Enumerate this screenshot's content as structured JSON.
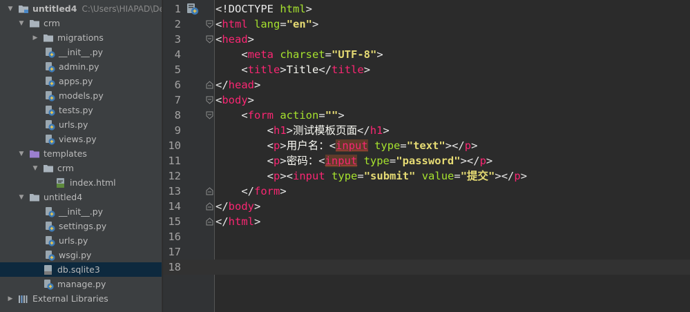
{
  "project_tree": {
    "root": {
      "label": "untitled4",
      "path": "C:\\Users\\HIAPAD\\Desk"
    },
    "items": [
      {
        "label": "crm",
        "kind": "folder",
        "expanded": true,
        "depth": 1
      },
      {
        "label": "migrations",
        "kind": "folder",
        "expanded": false,
        "depth": 2
      },
      {
        "label": "__init__.py",
        "kind": "python",
        "depth": 3
      },
      {
        "label": "admin.py",
        "kind": "python",
        "depth": 3
      },
      {
        "label": "apps.py",
        "kind": "python",
        "depth": 3
      },
      {
        "label": "models.py",
        "kind": "python",
        "depth": 3
      },
      {
        "label": "tests.py",
        "kind": "python",
        "depth": 3
      },
      {
        "label": "urls.py",
        "kind": "python",
        "depth": 3
      },
      {
        "label": "views.py",
        "kind": "python",
        "depth": 3
      },
      {
        "label": "templates",
        "kind": "folder-purple",
        "expanded": true,
        "depth": 1
      },
      {
        "label": "crm",
        "kind": "folder",
        "expanded": true,
        "depth": 2
      },
      {
        "label": "index.html",
        "kind": "html",
        "depth": 4
      },
      {
        "label": "untitled4",
        "kind": "folder",
        "expanded": true,
        "depth": 1
      },
      {
        "label": "__init__.py",
        "kind": "python",
        "depth": 3
      },
      {
        "label": "settings.py",
        "kind": "python",
        "depth": 3
      },
      {
        "label": "urls.py",
        "kind": "python",
        "depth": 3
      },
      {
        "label": "wsgi.py",
        "kind": "python",
        "depth": 3
      },
      {
        "label": "db.sqlite3",
        "kind": "db",
        "depth": 2,
        "selected": true
      },
      {
        "label": "manage.py",
        "kind": "python",
        "depth": 2
      },
      {
        "label": "External Libraries",
        "kind": "libraries",
        "expanded": false,
        "depth": 0
      }
    ]
  },
  "editor": {
    "current_line": 18,
    "lines": [
      {
        "num": "1",
        "tokens": [
          [
            "t-punct",
            "<!DOCTYPE "
          ],
          [
            "t-attr-a",
            "html"
          ],
          [
            "t-punct",
            ">"
          ]
        ]
      },
      {
        "num": "2",
        "tokens": [
          [
            "t-punct",
            "<"
          ],
          [
            "t-kw",
            "html"
          ],
          [
            "t-punct",
            " "
          ],
          [
            "t-attr-a",
            "lang"
          ],
          [
            "t-punct",
            "="
          ],
          [
            "t-str",
            "\"en\""
          ],
          [
            "t-punct",
            ">"
          ]
        ]
      },
      {
        "num": "3",
        "tokens": [
          [
            "t-punct",
            "<"
          ],
          [
            "t-kw",
            "head"
          ],
          [
            "t-punct",
            ">"
          ]
        ]
      },
      {
        "num": "4",
        "tokens": [
          [
            "t-punct",
            "    <"
          ],
          [
            "t-kw",
            "meta"
          ],
          [
            "t-punct",
            " "
          ],
          [
            "t-attr-a",
            "charset"
          ],
          [
            "t-punct",
            "="
          ],
          [
            "t-str",
            "\"UTF-8\""
          ],
          [
            "t-punct",
            ">"
          ]
        ]
      },
      {
        "num": "5",
        "tokens": [
          [
            "t-punct",
            "    <"
          ],
          [
            "t-kw",
            "title"
          ],
          [
            "t-punct",
            ">"
          ],
          [
            "t-text",
            "Title"
          ],
          [
            "t-punct",
            "</"
          ],
          [
            "t-kw",
            "title"
          ],
          [
            "t-punct",
            ">"
          ]
        ]
      },
      {
        "num": "6",
        "tokens": [
          [
            "t-punct",
            "</"
          ],
          [
            "t-kw",
            "head"
          ],
          [
            "t-punct",
            ">"
          ]
        ]
      },
      {
        "num": "7",
        "tokens": [
          [
            "t-punct",
            "<"
          ],
          [
            "t-kw",
            "body"
          ],
          [
            "t-punct",
            ">"
          ]
        ]
      },
      {
        "num": "8",
        "tokens": [
          [
            "t-punct",
            "    <"
          ],
          [
            "t-kw",
            "form"
          ],
          [
            "t-punct",
            " "
          ],
          [
            "t-attr-a",
            "action"
          ],
          [
            "t-punct",
            "="
          ],
          [
            "t-str",
            "\"\""
          ],
          [
            "t-punct",
            ">"
          ]
        ]
      },
      {
        "num": "9",
        "tokens": [
          [
            "t-punct",
            "        <"
          ],
          [
            "t-kw",
            "h1"
          ],
          [
            "t-punct",
            ">"
          ],
          [
            "t-text",
            "测试模板页面"
          ],
          [
            "t-punct",
            "</"
          ],
          [
            "t-kw",
            "h1"
          ],
          [
            "t-punct",
            ">"
          ]
        ]
      },
      {
        "num": "10",
        "tokens": [
          [
            "t-punct",
            "        <"
          ],
          [
            "t-kw",
            "p"
          ],
          [
            "t-punct",
            ">"
          ],
          [
            "t-text",
            "用户名："
          ],
          [
            "t-punct",
            "<"
          ],
          [
            "t-kw t-err",
            "input"
          ],
          [
            "t-punct",
            " "
          ],
          [
            "t-attr-a",
            "type"
          ],
          [
            "t-punct",
            "="
          ],
          [
            "t-str",
            "\"text\""
          ],
          [
            "t-punct",
            "></"
          ],
          [
            "t-kw",
            "p"
          ],
          [
            "t-punct",
            ">"
          ]
        ]
      },
      {
        "num": "11",
        "tokens": [
          [
            "t-punct",
            "        <"
          ],
          [
            "t-kw",
            "p"
          ],
          [
            "t-punct",
            ">"
          ],
          [
            "t-text",
            "密码："
          ],
          [
            "t-punct",
            "<"
          ],
          [
            "t-kw t-err",
            "input"
          ],
          [
            "t-punct",
            " "
          ],
          [
            "t-attr-a",
            "type"
          ],
          [
            "t-punct",
            "="
          ],
          [
            "t-str",
            "\"password\""
          ],
          [
            "t-punct",
            "></"
          ],
          [
            "t-kw",
            "p"
          ],
          [
            "t-punct",
            ">"
          ]
        ]
      },
      {
        "num": "12",
        "tokens": [
          [
            "t-punct",
            "        <"
          ],
          [
            "t-kw",
            "p"
          ],
          [
            "t-punct",
            "><"
          ],
          [
            "t-kw",
            "input"
          ],
          [
            "t-punct",
            " "
          ],
          [
            "t-attr-a",
            "type"
          ],
          [
            "t-punct",
            "="
          ],
          [
            "t-str",
            "\"submit\""
          ],
          [
            "t-punct",
            " "
          ],
          [
            "t-attr-a",
            "value"
          ],
          [
            "t-punct",
            "="
          ],
          [
            "t-str",
            "\"提交\""
          ],
          [
            "t-punct",
            "></"
          ],
          [
            "t-kw",
            "p"
          ],
          [
            "t-punct",
            ">"
          ]
        ]
      },
      {
        "num": "13",
        "tokens": [
          [
            "t-punct",
            "    </"
          ],
          [
            "t-kw",
            "form"
          ],
          [
            "t-punct",
            ">"
          ]
        ]
      },
      {
        "num": "14",
        "tokens": [
          [
            "t-punct",
            "</"
          ],
          [
            "t-kw",
            "body"
          ],
          [
            "t-punct",
            ">"
          ]
        ]
      },
      {
        "num": "15",
        "tokens": [
          [
            "t-punct",
            "</"
          ],
          [
            "t-kw",
            "html"
          ],
          [
            "t-punct",
            ">"
          ]
        ]
      },
      {
        "num": "16",
        "tokens": []
      },
      {
        "num": "17",
        "tokens": []
      },
      {
        "num": "18",
        "tokens": []
      }
    ]
  },
  "colors": {
    "sidebar_bg": "#3c3f41",
    "editor_bg": "#2b2b2b",
    "gutter_bg": "#313335",
    "selection_bg": "#0d293e",
    "tag_keyword": "#f92672",
    "attribute": "#a6e22e",
    "string": "#e6db74"
  }
}
